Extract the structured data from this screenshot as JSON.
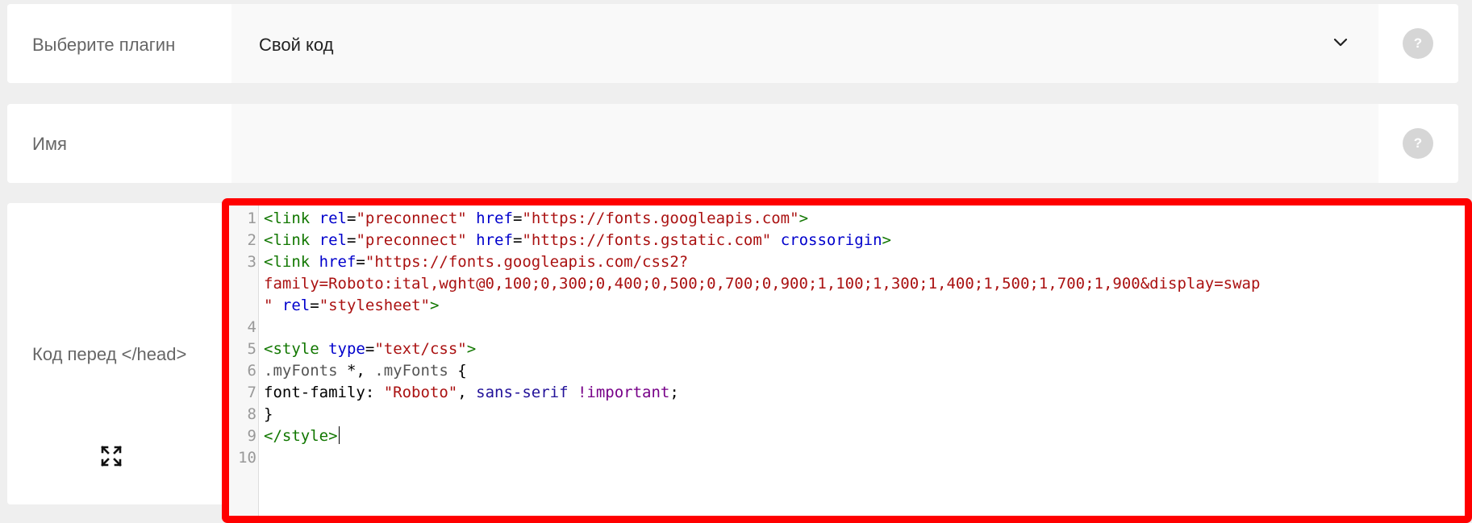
{
  "plugin_row": {
    "label": "Выберите плагин",
    "selected_value": "Свой код",
    "help": "?"
  },
  "name_row": {
    "label": "Имя",
    "value": "",
    "help": "?"
  },
  "code_row": {
    "label": "Код перед </head>",
    "help": "?",
    "expand_icon": "expand-icon"
  },
  "editor": {
    "frame_color": "#ff0000",
    "line_numbers": [
      "1",
      "2",
      "3",
      "4",
      "5",
      "6",
      "7",
      "8",
      "9",
      "10"
    ],
    "tokens": {
      "l1_open": "<link",
      "rel_attr": "rel",
      "eq": "=",
      "preconnect": "\"preconnect\"",
      "href_attr": "href",
      "l1_href": "\"https://fonts.googleapis.com\"",
      "close": ">",
      "l2_href": "\"https://fonts.gstatic.com\"",
      "crossorigin": "crossorigin",
      "l3_href_part1": "\"https://fonts.googleapis.com/css2?",
      "l3_href_part2": "family=Roboto:ital,wght@0,100;0,300;0,400;0,500;0,700;0,900;1,100;1,300;1,400;1,500;1,700;1,900&display=swap",
      "l3_href_part3": "\"",
      "stylesheet": "\"stylesheet\"",
      "style_open": "<style",
      "type_attr": "type",
      "text_css": "\"text/css\"",
      "my_fonts_1": ".myFonts",
      "star_sep": " *, ",
      "my_fonts_2": ".myFonts",
      "brace_open": " {",
      "font_family": "font-family",
      "colon": ": ",
      "roboto": "\"Roboto\"",
      "comma": ", ",
      "sans_serif": "sans-serif",
      "important": "!important",
      "semicolon": ";",
      "brace_close": "}",
      "style_close": "</style>"
    }
  }
}
